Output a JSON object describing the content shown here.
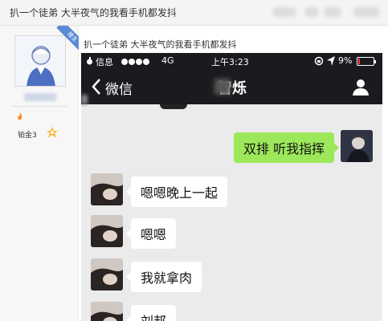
{
  "forum": {
    "thread_title": "扒一个徒弟 大半夜气的我看手机都发抖",
    "post_title": "扒一个徒弟 大半夜气的我看手机都发抖"
  },
  "poster": {
    "rank_label": "铂金3",
    "corner_tag": "楼主"
  },
  "phone": {
    "status": {
      "carrier": "信息",
      "network": "4G",
      "time": "上午3:23",
      "battery": "9%",
      "battery_level": 0.09
    },
    "nav": {
      "back_label": "微信",
      "chat_title": "智烁"
    },
    "messages": [
      {
        "side": "right",
        "text": "双排 听我指挥"
      },
      {
        "side": "left",
        "text": "嗯嗯晚上一起"
      },
      {
        "side": "left",
        "text": "嗯嗯"
      },
      {
        "side": "left",
        "text": "我就拿肉"
      },
      {
        "side": "left",
        "text": "刘邦"
      }
    ]
  },
  "colors": {
    "status_bar": "#1b1b1f",
    "chat_bg": "#ebebeb",
    "sent_bubble": "#9de85a",
    "received_bubble": "#ffffff",
    "battery_low": "#ff3b30"
  }
}
